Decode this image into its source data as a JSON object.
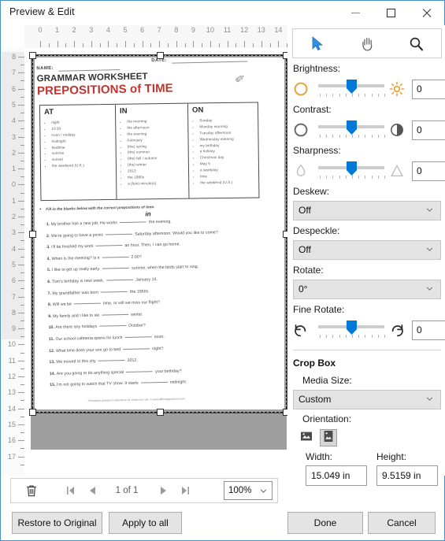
{
  "window": {
    "title": "Preview & Edit",
    "minimize_icon": "minimize-icon",
    "maximize_icon": "maximize-icon",
    "close_icon": "close-icon"
  },
  "toolbar": {
    "tools": [
      {
        "name": "select-tool",
        "icon": "arrow-cursor-icon",
        "selected": true
      },
      {
        "name": "pan-tool",
        "icon": "hand-icon",
        "selected": false
      },
      {
        "name": "zoom-tool",
        "icon": "magnifier-icon",
        "selected": false
      }
    ]
  },
  "rulers": {
    "horizontal": [
      "0",
      "1",
      "2",
      "3",
      "4",
      "5",
      "6",
      "7",
      "8",
      "9",
      "10",
      "11",
      "12",
      "13",
      "14"
    ],
    "vertical": [
      "8",
      "7",
      "6",
      "5",
      "4",
      "3",
      "2",
      "1",
      "0",
      "1",
      "2",
      "3",
      "4",
      "5",
      "6",
      "7",
      "8",
      "9",
      "10",
      "11",
      "12",
      "13",
      "14",
      "15",
      "16",
      "17"
    ],
    "units": "in"
  },
  "adjustments": [
    {
      "label": "Brightness:",
      "value": "0",
      "left_icon": "brightness-circle-icon",
      "right_icon": "sun-icon",
      "slider_percent": 50
    },
    {
      "label": "Contrast:",
      "value": "0",
      "left_icon": "contrast-circle-icon",
      "right_icon": "half-moon-icon",
      "slider_percent": 50
    },
    {
      "label": "Sharpness:",
      "value": "0",
      "left_icon": "droplet-icon",
      "right_icon": "triangle-icon",
      "slider_percent": 50
    }
  ],
  "dropdowns": [
    {
      "label": "Deskew:",
      "value": "Off"
    },
    {
      "label": "Despeckle:",
      "value": "Off"
    },
    {
      "label": "Rotate:",
      "value": "0°"
    }
  ],
  "fine_rotate": {
    "label": "Fine Rotate:",
    "value": "0",
    "left_icon": "rotate-left-icon",
    "right_icon": "rotate-right-icon",
    "slider_percent": 50
  },
  "crop_box": {
    "heading": "Crop Box",
    "media_size_label": "Media Size:",
    "media_size_value": "Custom",
    "orientation_label": "Orientation:",
    "orientation_landscape_icon": "landscape-orientation-icon",
    "orientation_portrait_icon": "portrait-orientation-icon",
    "orientation_selected": "portrait",
    "width_label": "Width:",
    "width_value": "15.049 in",
    "height_label": "Height:",
    "height_value": "9.5159 in"
  },
  "page_nav": {
    "delete_icon": "trash-icon",
    "first_icon": "first-page-icon",
    "prev_icon": "previous-page-icon",
    "page_text": "1 of 1",
    "next_icon": "next-page-icon",
    "last_icon": "last-page-icon",
    "fit_icon": "fit-to-window-icon",
    "zoom_value": "100%"
  },
  "footer": {
    "restore_label": "Restore to Original",
    "apply_all_label": "Apply to all",
    "done_label": "Done",
    "cancel_label": "Cancel"
  },
  "document": {
    "name_label": "NAME:",
    "date_label": "DATE:",
    "heading1": "GRAMMAR WORKSHEET",
    "heading2": "PREPOSITIONS of TIME",
    "pencil_icon": "pencil-icon",
    "columns": [
      {
        "header": "AT",
        "items": [
          "night",
          "10:30",
          "noon / midday",
          "midnight",
          "bedtime",
          "sunrise",
          "sunset",
          "the weekend (U.K.)"
        ]
      },
      {
        "header": "IN",
        "items": [
          "the morning",
          "the afternoon",
          "the evening",
          "February",
          "(the) spring",
          "(the) summer",
          "(the) fall / autumn",
          "(the) winter",
          "2013",
          "the 1980s",
          "a (few) minute(s)"
        ]
      },
      {
        "header": "ON",
        "items": [
          "Sunday",
          "Monday morning",
          "Tuesday afternoon",
          "Wednesday evening",
          "my birthday",
          "a holiday",
          "Christmas day",
          "May 5",
          "a weekday",
          "time",
          "the weekend (U.S.)"
        ]
      }
    ],
    "instruction": "Fill in the blanks below with the correct prepositions of time.",
    "example_answer": "in",
    "questions": [
      {
        "num": "1.",
        "pre": "My brother has a new job.  He works",
        "post": "the evening."
      },
      {
        "num": "2.",
        "pre": "We're going to have a picnic",
        "post": "Saturday afternoon.  Would you like to come?"
      },
      {
        "num": "3.",
        "pre": "I'll be finished my work",
        "post": "an hour.  Then, I can go home."
      },
      {
        "num": "4.",
        "pre": "When is the meeting?  Is it",
        "post": "2:00?"
      },
      {
        "num": "5.",
        "pre": "I like to get up really early.",
        "post": "sunrise, when the birds start to sing."
      },
      {
        "num": "6.",
        "pre": "Tom's birthday is next week.",
        "post": "January 14."
      },
      {
        "num": "7.",
        "pre": "My grandfather was born",
        "post": "the 1950s."
      },
      {
        "num": "8.",
        "pre": "Will we be",
        "post": "time, or will we miss our flight?"
      },
      {
        "num": "9.",
        "pre": "My family and I like to ski",
        "post": "winter."
      },
      {
        "num": "10.",
        "pre": "Are there any holidays",
        "post": "October?"
      },
      {
        "num": "11.",
        "pre": "Our school cafeteria opens for lunch",
        "post": "noon."
      },
      {
        "num": "12.",
        "pre": "What time does your son go to bed",
        "post": "night?"
      },
      {
        "num": "13.",
        "pre": "We moved to this city",
        "post": "2012."
      },
      {
        "num": "14.",
        "pre": "Are you going to do anything special",
        "post": "your birthday?"
      },
      {
        "num": "15.",
        "pre": "I'm not going to watch that TV show.  It starts",
        "post": "midnight."
      }
    ],
    "footer_text": "Permission granted to reproduce for classroom use.  © www.allthingsgrammar.com"
  },
  "colors": {
    "accent": "#0078d7",
    "title_red": "#c2352f",
    "orange": "#e8a33d",
    "panel_gray": "#9e9e9e"
  }
}
